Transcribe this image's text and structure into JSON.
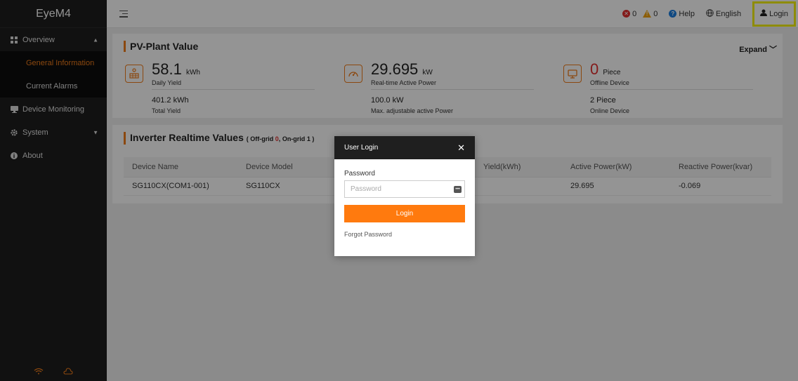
{
  "brand": "EyeM4",
  "sidebar": {
    "items": [
      {
        "label": "Overview"
      },
      {
        "label": "General Information"
      },
      {
        "label": "Current Alarms"
      },
      {
        "label": "Device Monitoring"
      },
      {
        "label": "System"
      },
      {
        "label": "About"
      }
    ]
  },
  "topbar": {
    "fault_count": "0",
    "alarm_count": "0",
    "help": "Help",
    "language": "English",
    "login": "Login"
  },
  "pv_plant": {
    "title": "PV-Plant Value",
    "expand": "Expand",
    "metrics": [
      {
        "value": "58.1",
        "unit": "kWh",
        "label": "Daily Yield",
        "sub_value": "401.2 kWh",
        "sub_label": "Total Yield"
      },
      {
        "value": "29.695",
        "unit": "kW",
        "label": "Real-time Active Power",
        "sub_value": "100.0 kW",
        "sub_label": "Max. adjustable active Power"
      },
      {
        "value": "0",
        "unit": "Piece",
        "label": "Offline Device",
        "sub_value": "2 Piece",
        "sub_label": "Online Device"
      }
    ]
  },
  "inverter": {
    "title": "Inverter Realtime Values",
    "off_grid_label": "Off-grid",
    "off_grid_count": "0",
    "on_grid_label": "On-grid",
    "on_grid_count": "1",
    "columns": [
      "Device Name",
      "Device Model",
      "Yield(kWh)",
      "Active Power(kW)",
      "Reactive Power(kvar)"
    ],
    "rows": [
      [
        "SG110CX(COM1-001)",
        "SG110CX",
        "",
        "29.695",
        "-0.069"
      ]
    ]
  },
  "modal": {
    "title": "User Login",
    "password_label": "Password",
    "password_placeholder": "Password",
    "login_button": "Login",
    "forgot": "Forgot Password"
  },
  "colors": {
    "accent": "#ff7a0e",
    "sidebar_bg": "#1e1e1e",
    "highlight": "#f4f20a"
  }
}
